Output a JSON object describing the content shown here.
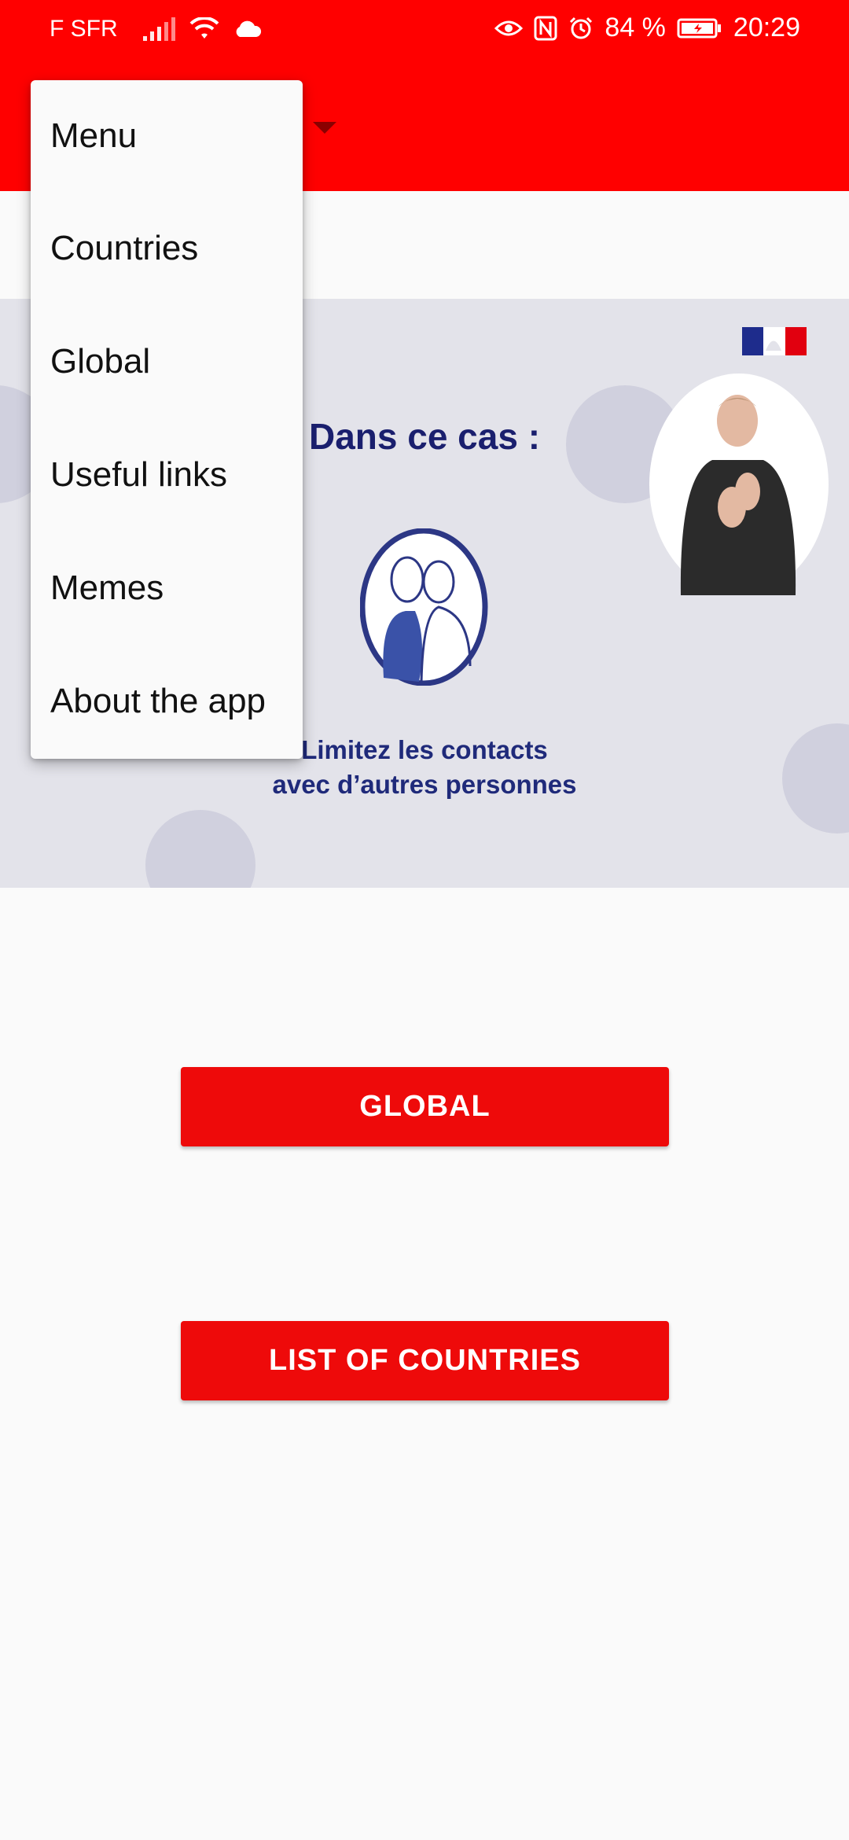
{
  "status_bar": {
    "carrier": "F SFR",
    "battery": "84 %",
    "time": "20:29",
    "icons": [
      "signal-icon",
      "wifi-icon",
      "cloud-icon",
      "eye-icon",
      "nfc-icon",
      "alarm-icon",
      "battery-icon"
    ]
  },
  "colors": {
    "app_bar": "#ff0000",
    "button": "#ee0a0a",
    "banner_text": "#1a1f6e"
  },
  "menu": {
    "items": [
      {
        "label": "Menu"
      },
      {
        "label": "Countries"
      },
      {
        "label": "Global"
      },
      {
        "label": "Useful links"
      },
      {
        "label": "Memes"
      },
      {
        "label": "About the app"
      }
    ]
  },
  "banner": {
    "heading": "Dans ce cas :",
    "caption_line1": "Limitez les contacts",
    "caption_line2": "avec d’autres personnes"
  },
  "buttons": {
    "global": "GLOBAL",
    "countries": "LIST OF COUNTRIES"
  }
}
